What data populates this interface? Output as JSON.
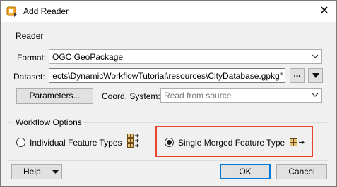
{
  "window": {
    "title": "Add Reader",
    "close_glyph": "✕"
  },
  "reader_group": {
    "label": "Reader",
    "format_label": "Format:",
    "format_value": "OGC GeoPackage",
    "dataset_label": "Dataset:",
    "dataset_value": "ects\\DynamicWorkflowTutorial\\resources\\CityDatabase.gpkg\"",
    "browse_label": "...",
    "parameters_label": "Parameters...",
    "coord_label": "Coord. System:",
    "coord_placeholder": "Read from source"
  },
  "workflow_group": {
    "label": "Workflow Options",
    "options": [
      {
        "label": "Individual Feature Types",
        "checked": false,
        "icon": "multi-table-icon"
      },
      {
        "label": "Single Merged Feature Type",
        "checked": true,
        "icon": "merge-table-icon"
      }
    ],
    "highlight_color": "#e8452c"
  },
  "footer": {
    "help_label": "Help",
    "ok_label": "OK",
    "cancel_label": "Cancel"
  },
  "colors": {
    "focus_blue": "#0078d7",
    "icon_orange": "#e07b1a"
  }
}
